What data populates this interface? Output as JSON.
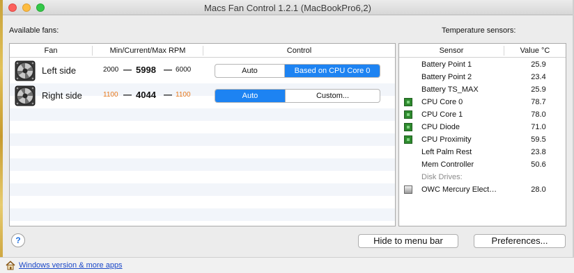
{
  "window": {
    "title": "Macs Fan Control 1.2.1 (MacBookPro6,2)"
  },
  "labels": {
    "available_fans": "Available fans:",
    "temperature_sensors": "Temperature sensors:"
  },
  "fans_table": {
    "headers": {
      "fan": "Fan",
      "rpm": "Min/Current/Max RPM",
      "control": "Control"
    },
    "rows": [
      {
        "name": "Left side",
        "min": "2000",
        "current": "5998",
        "max": "6000",
        "min_max_color": "#111111",
        "control_left": "Auto",
        "control_right": "Based on CPU Core 0",
        "active_segment": "right"
      },
      {
        "name": "Right side",
        "min": "1100",
        "current": "4044",
        "max": "1100",
        "min_max_color": "#e8781a",
        "control_left": "Auto",
        "control_right": "Custom...",
        "active_segment": "left"
      }
    ]
  },
  "sensor_table": {
    "headers": {
      "sensor": "Sensor",
      "value": "Value °C"
    },
    "rows": [
      {
        "icon": "none",
        "name": "Battery Point 1",
        "value": "25.9"
      },
      {
        "icon": "none",
        "name": "Battery Point 2",
        "value": "23.4"
      },
      {
        "icon": "none",
        "name": "Battery TS_MAX",
        "value": "25.9"
      },
      {
        "icon": "chip-icon",
        "name": "CPU Core 0",
        "value": "78.7"
      },
      {
        "icon": "chip-icon",
        "name": "CPU Core 1",
        "value": "78.0"
      },
      {
        "icon": "chip-icon",
        "name": "CPU Diode",
        "value": "71.0"
      },
      {
        "icon": "chip-icon",
        "name": "CPU Proximity",
        "value": "59.5"
      },
      {
        "icon": "none",
        "name": "Left Palm Rest",
        "value": "23.8"
      },
      {
        "icon": "none",
        "name": "Mem Controller",
        "value": "50.6"
      },
      {
        "icon": "none",
        "name": "Disk Drives:",
        "value": "",
        "group": true
      },
      {
        "icon": "disk-icon",
        "name": "OWC Mercury Elect…",
        "value": "28.0"
      }
    ]
  },
  "buttons": {
    "help": "?",
    "hide_to_menu_bar": "Hide to menu bar",
    "preferences": "Preferences..."
  },
  "footer": {
    "link": "Windows version & more apps"
  },
  "colors": {
    "accent": "#1d83f2",
    "orange": "#e8781a",
    "link": "#1a47c8"
  }
}
